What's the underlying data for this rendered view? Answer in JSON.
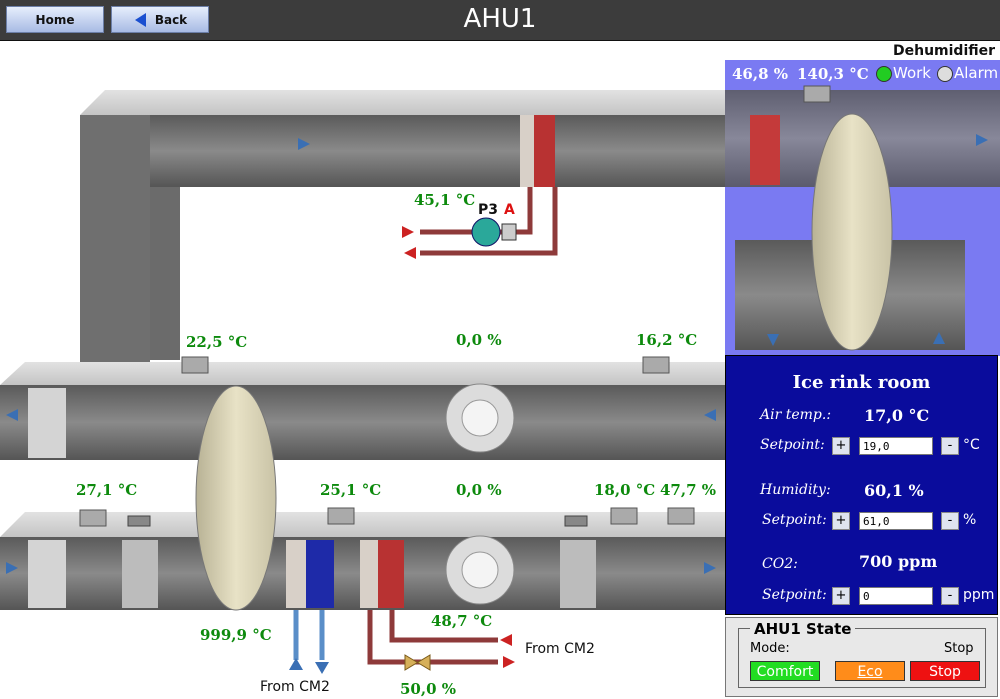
{
  "header": {
    "home_label": "Home",
    "back_label": "Back",
    "title": "AHU1"
  },
  "dehumidifier": {
    "title": "Dehumidifier",
    "humidity": "46,8 %",
    "temp": "140,3 °C",
    "work_label": "Work",
    "alarm_label": "Alarm",
    "work_color": "#22cc22",
    "alarm_color": "#dddddd"
  },
  "readings": {
    "pump_temp": "45,1 °C",
    "pump_name": "P3",
    "pump_mode": "A",
    "exhaust_temp": "22,5 °C",
    "exhaust_fan": "0,0 %",
    "exhaust_temp2": "16,2 °C",
    "outdoor_temp": "27,1 °C",
    "supply_temp1": "25,1 °C",
    "supply_fan": "0,0 %",
    "supply_temp2": "18,0 °C",
    "supply_humidity": "47,7 %",
    "cooling_temp": "999,9 °C",
    "heating_temp": "48,7 °C",
    "valve": "50,0 %",
    "from_cm2_a": "From CM2",
    "from_cm2_b": "From CM2"
  },
  "room": {
    "title": "Ice rink room",
    "air_label": "Air temp.:",
    "air_value": "17,0 °C",
    "sp1_label": "Setpoint:",
    "sp1_value": "19,0",
    "sp1_unit": "°C",
    "hum_label": "Humidity:",
    "hum_value": "60,1 %",
    "sp2_label": "Setpoint:",
    "sp2_value": "61,0",
    "sp2_unit": "%",
    "co2_label": "CO2:",
    "co2_value": "700 ppm",
    "sp3_label": "Setpoint:",
    "sp3_value": "0",
    "sp3_unit": "ppm",
    "plus": "+",
    "minus": "-"
  },
  "state": {
    "title": "AHU1 State",
    "mode_label": "Mode:",
    "mode_value": "Stop",
    "comfort": "Comfort",
    "eco": "Eco",
    "stop": "Stop",
    "comfort_color": "#22dd22",
    "eco_color": "#ff8c1a",
    "stop_color": "#ee1111"
  }
}
